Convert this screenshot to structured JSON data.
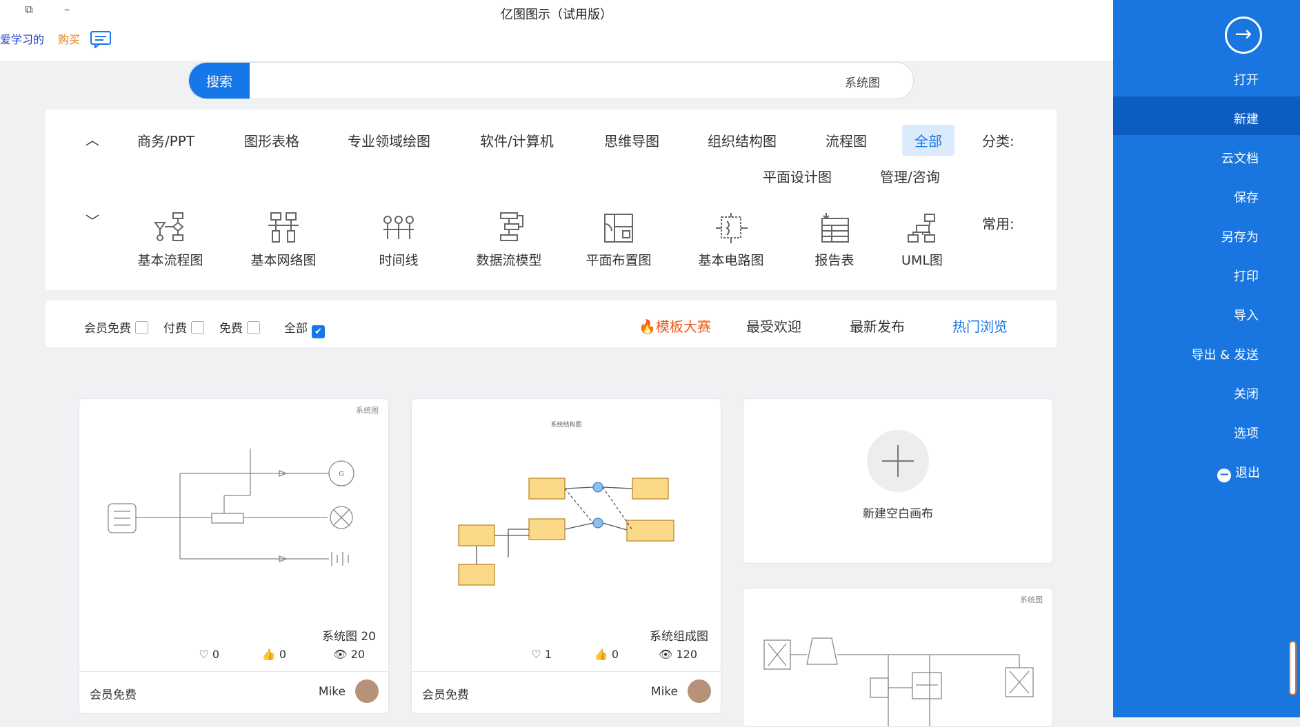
{
  "window": {
    "title": "亿图图示（试用版）",
    "links": {
      "buy": "购买",
      "study": "爱学习的"
    }
  },
  "search": {
    "button": "搜索",
    "value": "系统图"
  },
  "categories": {
    "label": "分类:",
    "items": [
      "全部",
      "流程图",
      "组织结构图",
      "思维导图",
      "软件/计算机",
      "专业领域绘图",
      "图形表格",
      "商务/PPT",
      "管理/咨询",
      "平面设计图"
    ]
  },
  "common": {
    "label": "常用:",
    "items": [
      "UML图",
      "报告表",
      "基本电路图",
      "平面布置图",
      "数据流模型",
      "时间线",
      "基本网络图",
      "基本流程图"
    ]
  },
  "filter": {
    "tabs": [
      "热门浏览",
      "最新发布",
      "最受欢迎",
      "模板大赛"
    ],
    "checks": [
      {
        "label": "全部",
        "checked": true
      },
      {
        "label": "免费",
        "checked": false
      },
      {
        "label": "付费",
        "checked": false
      },
      {
        "label": "会员免费",
        "checked": false
      }
    ]
  },
  "cards": {
    "new_blank": "新建空白画布",
    "c1": {
      "tag": "系统图",
      "title": "系统图 20",
      "views": "20",
      "likes": "0",
      "favs": "0",
      "author": "Mike",
      "price": "会员免费"
    },
    "c2": {
      "tag": "系统结构图",
      "title": "系统组成图",
      "views": "120",
      "likes": "0",
      "favs": "1",
      "author": "Mike",
      "price": "会员免费"
    },
    "c3": {
      "tag": "系统图"
    }
  },
  "sidebar": {
    "items": [
      "打开",
      "新建",
      "云文档",
      "保存",
      "另存为",
      "打印",
      "导入",
      "导出 & 发送",
      "关闭",
      "选项",
      "退出"
    ],
    "selected": "新建"
  },
  "colors": {
    "accent": "#1677e8",
    "sidebar": "#1976e0",
    "contest": "#f05a1a"
  }
}
